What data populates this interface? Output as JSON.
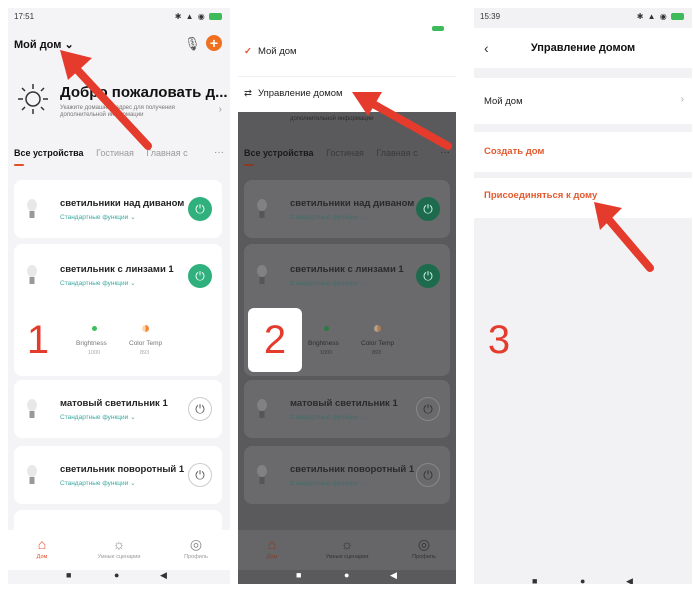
{
  "colors": {
    "accent": "#e5502b",
    "power_on": "#2fb07d",
    "function_text": "#3aa8a0",
    "annotation_red": "#e53b2c"
  },
  "step_numbers": [
    "1",
    "2",
    "3"
  ],
  "panel1": {
    "status": {
      "time": "17:51"
    },
    "home_title": "Мой дом",
    "welcome": {
      "title": "Добро пожаловать д...",
      "subtitle": "Укажите домашний адрес для получения дополнительной информации"
    },
    "tabs": [
      "Все устройства",
      "Гостиная",
      "Главная с"
    ],
    "devices": [
      {
        "name": "светильники над диваном",
        "function": "Стандартные функции",
        "state": "on"
      },
      {
        "name": "светильник с линзами 1",
        "function": "Стандартные функции",
        "state": "on"
      },
      {
        "name": "матовый светильник 1",
        "function": "Стандартные функции",
        "state": "off"
      },
      {
        "name": "светильник поворотный 1",
        "function": "Стандартные функции",
        "state": "off"
      }
    ],
    "controls": [
      {
        "label": "Brightness",
        "value": "1000"
      },
      {
        "label": "Color Temp",
        "value": "893"
      }
    ],
    "nav": [
      {
        "label": "Дом",
        "icon": "home-icon"
      },
      {
        "label": "Умные сценарии",
        "icon": "scenes-icon"
      },
      {
        "label": "Профиль",
        "icon": "profile-icon"
      }
    ]
  },
  "panel2": {
    "menu": [
      {
        "label": "Мой дом",
        "icon": "check-icon"
      },
      {
        "label": "Управление домом",
        "icon": "sliders-icon"
      }
    ],
    "hidden_subtitle": "дополнительной информации",
    "tabs": [
      "Все устройства",
      "Гостиная",
      "Главная с"
    ],
    "devices": [
      {
        "name": "светильники над диваном",
        "function": "Стандартные функции"
      },
      {
        "name": "светильник с линзами 1",
        "function": "Стандартные функции"
      },
      {
        "name": "матовый светильник 1",
        "function": "Стандартные функции"
      },
      {
        "name": "светильник поворотный 1",
        "function": "Стандартные функции"
      }
    ],
    "controls": [
      {
        "label": "Brightness",
        "value": "1000"
      },
      {
        "label": "Color Temp",
        "value": "893"
      }
    ],
    "nav": [
      {
        "label": "Дом"
      },
      {
        "label": "Умные сценарии"
      },
      {
        "label": "Профиль"
      }
    ]
  },
  "panel3": {
    "status": {
      "time": "15:39"
    },
    "title": "Управление домом",
    "rows": [
      "Мой дом",
      "Создать дом",
      "Присоединяться к дому"
    ]
  }
}
